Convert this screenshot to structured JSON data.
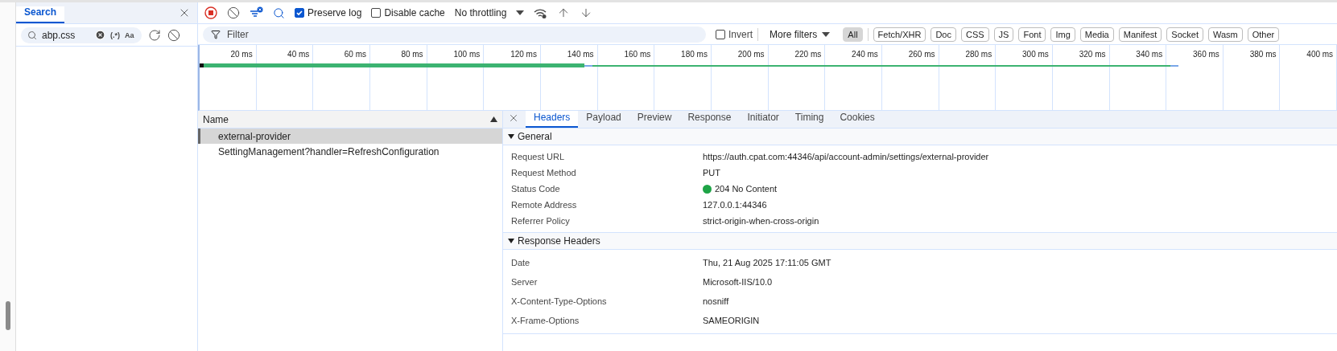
{
  "search_panel": {
    "tab": "Search",
    "query": "abp.css",
    "regex_toggle": "(.*)",
    "case_toggle": "Aa"
  },
  "toolbar": {
    "preserve_log": {
      "label": "Preserve log",
      "checked": true
    },
    "disable_cache": {
      "label": "Disable cache",
      "checked": false
    },
    "throttling": "No throttling"
  },
  "filter_bar": {
    "placeholder": "Filter",
    "invert": {
      "label": "Invert",
      "checked": false
    },
    "more_filters": "More filters",
    "types": [
      {
        "label": "All",
        "selected": true
      },
      {
        "label": "Fetch/XHR",
        "selected": false
      },
      {
        "label": "Doc",
        "selected": false
      },
      {
        "label": "CSS",
        "selected": false
      },
      {
        "label": "JS",
        "selected": false
      },
      {
        "label": "Font",
        "selected": false
      },
      {
        "label": "Img",
        "selected": false
      },
      {
        "label": "Media",
        "selected": false
      },
      {
        "label": "Manifest",
        "selected": false
      },
      {
        "label": "Socket",
        "selected": false
      },
      {
        "label": "Wasm",
        "selected": false
      },
      {
        "label": "Other",
        "selected": false
      }
    ]
  },
  "timeline": {
    "ticks": [
      "20 ms",
      "40 ms",
      "60 ms",
      "80 ms",
      "100 ms",
      "120 ms",
      "140 ms",
      "160 ms",
      "180 ms",
      "200 ms",
      "220 ms",
      "240 ms",
      "260 ms",
      "280 ms",
      "300 ms",
      "320 ms",
      "340 ms",
      "360 ms",
      "380 ms",
      "400 ms"
    ]
  },
  "requests": {
    "column": "Name",
    "rows": [
      {
        "name": "external-provider",
        "selected": true
      },
      {
        "name": "SettingManagement?handler=RefreshConfiguration",
        "selected": false
      }
    ]
  },
  "details": {
    "tabs": [
      {
        "label": "Headers",
        "selected": true
      },
      {
        "label": "Payload",
        "selected": false
      },
      {
        "label": "Preview",
        "selected": false
      },
      {
        "label": "Response",
        "selected": false
      },
      {
        "label": "Initiator",
        "selected": false
      },
      {
        "label": "Timing",
        "selected": false
      },
      {
        "label": "Cookies",
        "selected": false
      }
    ],
    "sections": [
      {
        "title": "General",
        "expanded": true,
        "rows": [
          {
            "key": "Request URL",
            "value": "https://auth.cpat.com:44346/api/account-admin/settings/external-provider"
          },
          {
            "key": "Request Method",
            "value": "PUT"
          },
          {
            "key": "Status Code",
            "value": "204 No Content",
            "color": "#1ea446"
          },
          {
            "key": "Remote Address",
            "value": "127.0.0.1:44346"
          },
          {
            "key": "Referrer Policy",
            "value": "strict-origin-when-cross-origin"
          }
        ]
      },
      {
        "title": "Response Headers",
        "expanded": true,
        "rows": [
          {
            "key": "Date",
            "value": "Thu, 21 Aug 2025 17:11:05 GMT"
          },
          {
            "key": "Server",
            "value": "Microsoft-IIS/10.0"
          },
          {
            "key": "X-Content-Type-Options",
            "value": "nosniff"
          },
          {
            "key": "X-Frame-Options",
            "value": "SAMEORIGIN"
          }
        ]
      }
    ]
  }
}
